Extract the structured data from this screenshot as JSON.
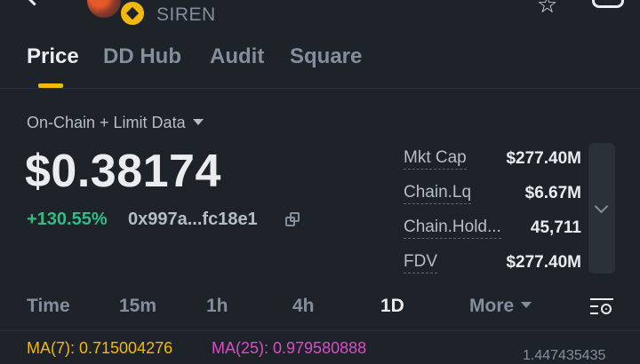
{
  "header": {
    "ticker": "SIREN",
    "icons": [
      "back-icon",
      "token-avatar",
      "bnb-chain-badge",
      "star-icon",
      "bell-icon"
    ]
  },
  "tabs": [
    {
      "label": "Price",
      "active": true
    },
    {
      "label": "DD Hub",
      "active": false
    },
    {
      "label": "Audit",
      "active": false
    },
    {
      "label": "Square",
      "active": false
    }
  ],
  "source": {
    "label": "On-Chain + Limit Data"
  },
  "price": {
    "value": "$0.38174",
    "change": "+130.55%",
    "address": "0x997a...fc18e1"
  },
  "stats": [
    {
      "label": "Mkt Cap",
      "value": "$277.40M"
    },
    {
      "label": "Chain.Lq",
      "value": "$6.67M"
    },
    {
      "label": "Chain.Hold...",
      "value": "45,711"
    },
    {
      "label": "FDV",
      "value": "$277.40M"
    }
  ],
  "intervals": [
    {
      "label": "Time",
      "active": false
    },
    {
      "label": "15m",
      "active": false
    },
    {
      "label": "1h",
      "active": false
    },
    {
      "label": "4h",
      "active": false
    },
    {
      "label": "1D",
      "active": true
    },
    {
      "label": "More",
      "active": false
    }
  ],
  "chart": {
    "ma7": "MA(7): 0.715004276",
    "ma25": "MA(25): 0.979580888",
    "axis_top": "1.447435435"
  },
  "colors": {
    "background": "#1e2329",
    "accent": "#f0b90b",
    "positive": "#2ebd85",
    "ma25": "#d84ec4"
  }
}
